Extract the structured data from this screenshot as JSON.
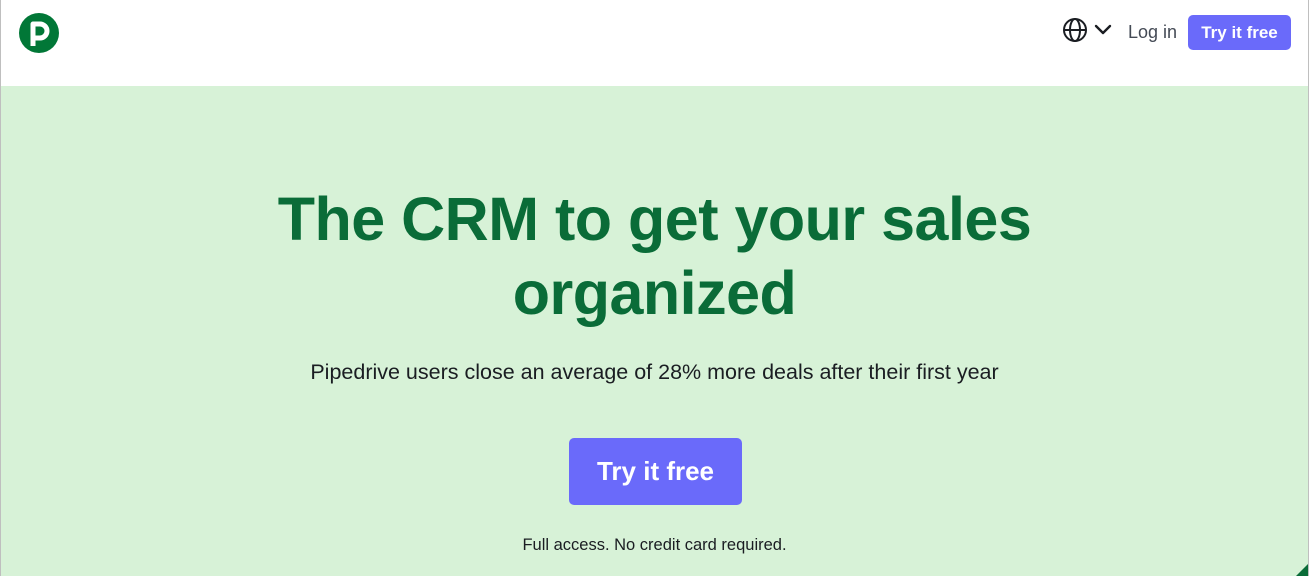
{
  "colors": {
    "brand_green": "#017737",
    "headline_green": "#0a6c38",
    "hero_background": "#d7f2d7",
    "cta_purple": "#6a6afa"
  },
  "header": {
    "logo_icon": "pipedrive-p-logo-icon",
    "language_icon": "globe-icon",
    "language_dropdown_icon": "chevron-down-icon",
    "login_label": "Log in",
    "cta_label": "Try it free"
  },
  "hero": {
    "title_line_1": "The CRM to get your sales",
    "title_line_2": "organized",
    "subtitle": "Pipedrive users close an average of 28% more deals after their first year",
    "cta_label": "Try it free",
    "note": "Full access. No credit card required."
  }
}
